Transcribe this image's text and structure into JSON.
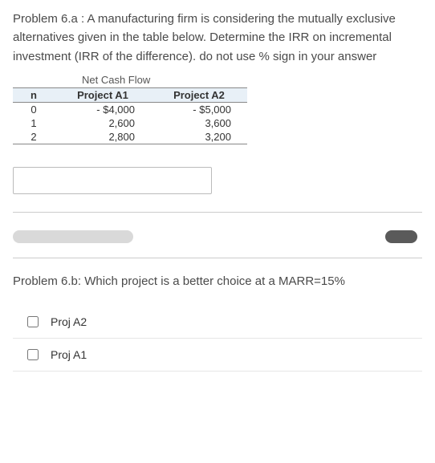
{
  "problem_a": {
    "text": "Problem 6.a :  A manufacturing firm is considering the mutually exclusive alternatives given in the table below. Determine  the IRR on incremental investment (IRR of the difference). do not use % sign in your answer"
  },
  "table": {
    "super_header": "Net Cash Flow",
    "headers": {
      "n": "n",
      "a1": "Project A1",
      "a2": "Project A2"
    },
    "rows": [
      {
        "n": "0",
        "a1": "- $4,000",
        "a2": "- $5,000"
      },
      {
        "n": "1",
        "a1": "2,600",
        "a2": "3,600"
      },
      {
        "n": "2",
        "a1": "2,800",
        "a2": "3,200"
      }
    ]
  },
  "answer_input": {
    "value": ""
  },
  "problem_b": {
    "text": "Problem 6.b: Which project is a better choice at a MARR=15%"
  },
  "options": [
    {
      "label": "Proj A2"
    },
    {
      "label": "Proj A1"
    }
  ]
}
